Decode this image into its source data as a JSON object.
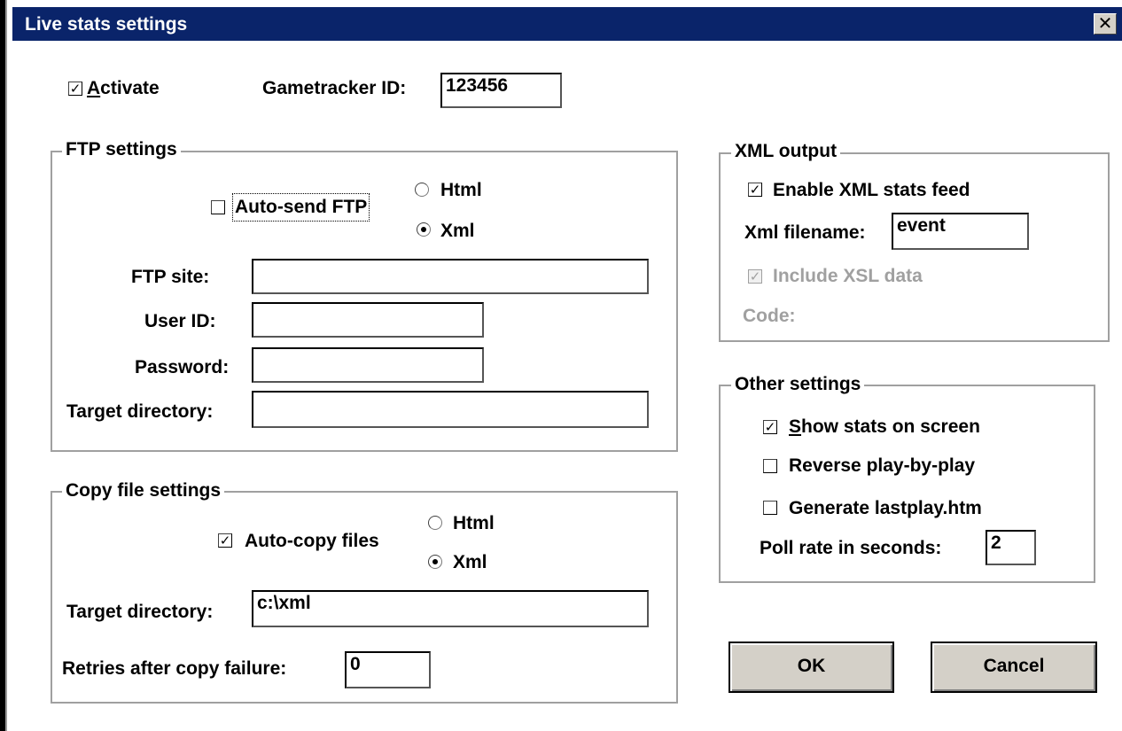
{
  "window": {
    "title": "Live stats settings",
    "close_glyph": "✕"
  },
  "top": {
    "activate_label_first": "A",
    "activate_label_rest": "ctivate",
    "activate_checked": true,
    "gametracker_label": "Gametracker ID:",
    "gametracker_value": "123456"
  },
  "ftp": {
    "legend": "FTP settings",
    "auto_send_label": "Auto-send FTP",
    "auto_send_checked": false,
    "format_html": "Html",
    "format_xml": "Xml",
    "format_selected": "Xml",
    "site_label": "FTP site:",
    "site_value": "",
    "user_label": "User ID:",
    "user_value": "",
    "password_label": "Password:",
    "password_value": "",
    "target_label": "Target directory:",
    "target_value": ""
  },
  "copy": {
    "legend": "Copy file settings",
    "auto_copy_label": "Auto-copy files",
    "auto_copy_checked": true,
    "format_html": "Html",
    "format_xml": "Xml",
    "format_selected": "Xml",
    "target_label": "Target directory:",
    "target_value": "c:\\xml",
    "retries_label": "Retries after copy failure:",
    "retries_value": "0"
  },
  "xml": {
    "legend": "XML output",
    "enable_label": "Enable XML stats feed",
    "enable_checked": true,
    "filename_label": "Xml filename:",
    "filename_value": "event",
    "include_xsl_label": "Include XSL data",
    "include_xsl_checked": true,
    "code_label": "Code:"
  },
  "other": {
    "legend": "Other settings",
    "show_stats_first": "S",
    "show_stats_rest": "how stats on screen",
    "show_stats_checked": true,
    "reverse_label": "Reverse play-by-play",
    "reverse_checked": false,
    "lastplay_label": "Generate lastplay.htm",
    "lastplay_checked": false,
    "poll_label": "Poll rate in seconds:",
    "poll_value": "2"
  },
  "buttons": {
    "ok_label": "OK",
    "cancel_label": "Cancel"
  },
  "icons": {
    "checkmark": "✓"
  },
  "colors": {
    "titlebar": "#0a246a",
    "button_face": "#d4d0c8",
    "group_border": "#a0a0a0",
    "disabled_text": "#a0a0a0"
  }
}
